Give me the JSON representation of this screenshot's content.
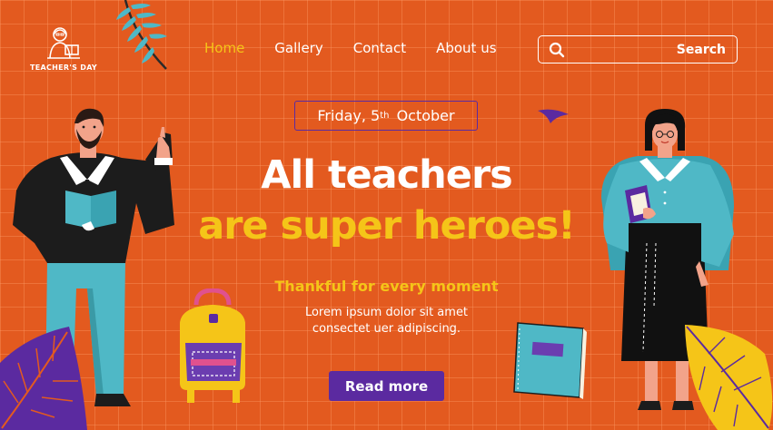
{
  "brand": {
    "logo_text": "TEACHER'S DAY"
  },
  "nav": {
    "items": [
      {
        "label": "Home",
        "active": true
      },
      {
        "label": "Gallery",
        "active": false
      },
      {
        "label": "Contact",
        "active": false
      },
      {
        "label": "About us",
        "active": false
      }
    ]
  },
  "search": {
    "label": "Search",
    "icon": "search-icon"
  },
  "hero": {
    "date_prefix": "Friday, 5",
    "date_suffix": "th",
    "date_rest": "October",
    "headline_line1": "All teachers",
    "headline_line2": "are super heroes!",
    "tagline": "Thankful for every moment",
    "body_line1": "Lorem ipsum dolor sit amet",
    "body_line2": "consectet uer adipiscing.",
    "cta_label": "Read more"
  },
  "colors": {
    "background": "#e35a1f",
    "accent_yellow": "#f5c518",
    "accent_purple": "#5b2aa0",
    "text_white": "#ffffff",
    "teal": "#4fb8c6"
  }
}
